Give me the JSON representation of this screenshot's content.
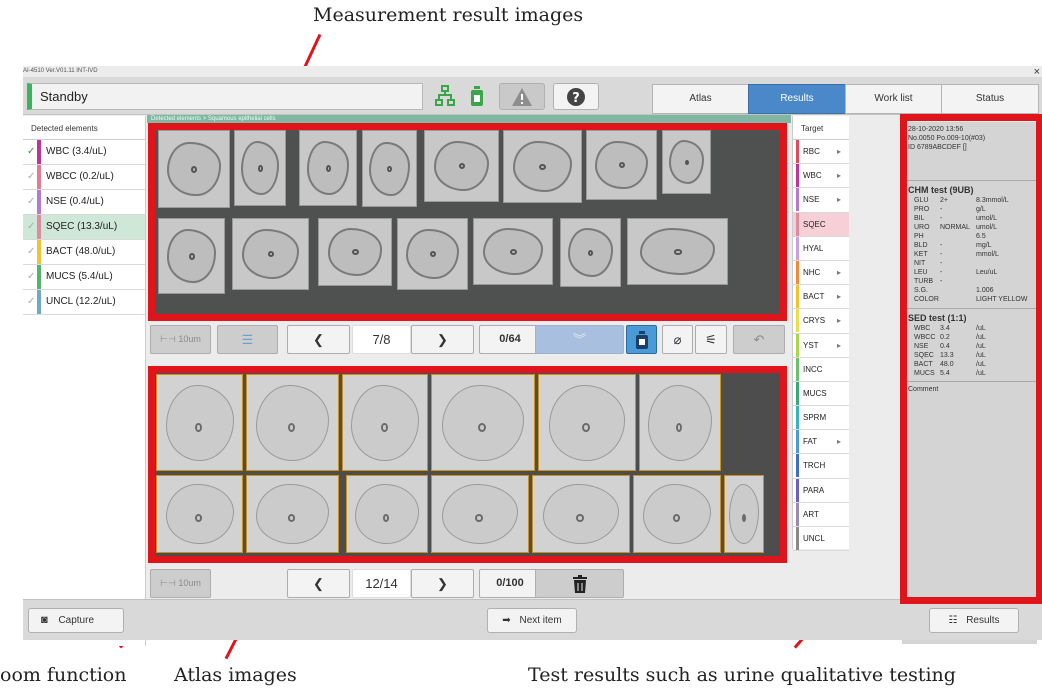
{
  "callouts": {
    "measurement": "Measurement result images",
    "zoom": "oom function",
    "atlas": "Atlas images",
    "tests": "Test results such as urine qualitative testing"
  },
  "app": {
    "version": "AI-4510 Ver.V01.11 INT-IVD",
    "close_glyph": "×",
    "status": "Standby",
    "status_color": "#3bb35a",
    "tabs": [
      "Atlas",
      "Results",
      "Work list",
      "Status"
    ],
    "active_tab": "Results",
    "accent": "#4a88c9",
    "highlight_color": "#e0141b"
  },
  "detected": {
    "header": "Detected elements",
    "items": [
      {
        "label": "WBC (3.4/uL)",
        "color": "#c2339a",
        "checked": true
      },
      {
        "label": "WBCC (0.2/uL)",
        "color": "#e27b9a",
        "checked": false
      },
      {
        "label": "NSE (0.4/uL)",
        "color": "#b37bd0",
        "checked": false
      },
      {
        "label": "SQEC (13.3/uL)",
        "color": "#e08aa2",
        "checked": false,
        "selected": true
      },
      {
        "label": "BACT (48.0/uL)",
        "color": "#f2c230",
        "checked": false
      },
      {
        "label": "MUCS (5.4/uL)",
        "color": "#53b569",
        "checked": false
      },
      {
        "label": "UNCL (12.2/uL)",
        "color": "#6fa8c8",
        "checked": false
      }
    ]
  },
  "breadcrumb": "Detected elements > Squamous epithelial cells",
  "measure": {
    "scale": "10um",
    "page": "7/8",
    "selected": "0/64"
  },
  "atlas": {
    "scale": "10um",
    "page": "12/14",
    "selected": "0/100"
  },
  "targets": {
    "header": "Target",
    "items": [
      {
        "label": "RBC",
        "color": "#e04a5a",
        "arrow": true
      },
      {
        "label": "WBC",
        "color": "#c2339a",
        "arrow": true
      },
      {
        "label": "NSE",
        "color": "#b37bd0",
        "arrow": true
      },
      {
        "label": "SQEC",
        "color": "#e08aa2",
        "arrow": false,
        "selected": true
      },
      {
        "label": "HYAL",
        "color": "#c9a0e0",
        "arrow": false
      },
      {
        "label": "NHC",
        "color": "#f08a3a",
        "arrow": true
      },
      {
        "label": "BACT",
        "color": "#f2c230",
        "arrow": true
      },
      {
        "label": "CRYS",
        "color": "#e8e04a",
        "arrow": true
      },
      {
        "label": "YST",
        "color": "#a8d84a",
        "arrow": true
      },
      {
        "label": "INCC",
        "color": "#6cc26c",
        "arrow": false
      },
      {
        "label": "MUCS",
        "color": "#3aa878",
        "arrow": false
      },
      {
        "label": "SPRM",
        "color": "#38b4b8",
        "arrow": false
      },
      {
        "label": "FAT",
        "color": "#4a9ad8",
        "arrow": true
      },
      {
        "label": "TRCH",
        "color": "#3f6fc4",
        "arrow": false
      },
      {
        "label": "PARA",
        "color": "#6a5fc4",
        "arrow": false
      },
      {
        "label": "ART",
        "color": "#9a8ab0",
        "arrow": false
      },
      {
        "label": "UNCL",
        "color": "#8a8a8a",
        "arrow": false
      }
    ]
  },
  "results": {
    "date": "28-10-2020 13:56",
    "no": "No.0050 Po.009-10(#03)",
    "id": "ID 6789ABCDEF []",
    "chm_title": "CHM test (9UB)",
    "chm": [
      [
        "GLU",
        "2+",
        "8.3mmol/L"
      ],
      [
        "PRO",
        "-",
        "g/L"
      ],
      [
        "BIL",
        "-",
        "umol/L"
      ],
      [
        "URO",
        "NORMAL",
        "umol/L"
      ],
      [
        "PH",
        "",
        "6.5"
      ],
      [
        "BLD",
        "-",
        "mg/L"
      ],
      [
        "KET",
        "-",
        "mmol/L"
      ],
      [
        "NIT",
        "-",
        ""
      ],
      [
        "LEU",
        "-",
        "Leu/uL"
      ],
      [
        "TURB",
        "-",
        ""
      ],
      [
        "S.G.",
        "",
        "1.006"
      ],
      [
        "COLOR",
        "",
        "LIGHT YELLOW"
      ]
    ],
    "sed_title": "SED test (1:1)",
    "sed": [
      [
        "WBC",
        "3.4",
        "/uL"
      ],
      [
        "WBCC",
        "0.2",
        "/uL"
      ],
      [
        "NSE",
        "0.4",
        "/uL"
      ],
      [
        "SQEC",
        "13.3",
        "/uL"
      ],
      [
        "BACT",
        "48.0",
        "/uL"
      ],
      [
        "MUCS",
        "5.4",
        "/uL"
      ]
    ],
    "comment_label": "Comment"
  },
  "bottom": {
    "capture": "Capture",
    "next": "Next item",
    "results": "Results"
  },
  "icons": {
    "network": "network-icon",
    "bottle": "bottle-icon",
    "warning": "warning-icon",
    "help": "help-icon",
    "prev": "chevron-left-icon",
    "next": "chevron-right-icon",
    "trash": "trash-icon"
  }
}
